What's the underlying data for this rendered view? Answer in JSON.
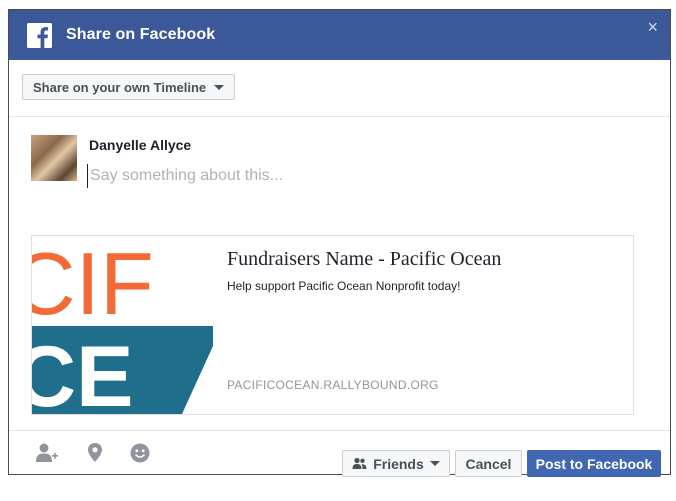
{
  "header": {
    "title": "Share on Facebook",
    "close_label": "×"
  },
  "selector": {
    "label": "Share on your own Timeline"
  },
  "composer": {
    "user_name": "Danyelle Allyce",
    "placeholder": "Say something about this...",
    "value": ""
  },
  "preview": {
    "title": "Fundraisers Name - Pacific Ocean",
    "description": "Help support Pacific Ocean Nonprofit today!",
    "url": "PACIFICOCEAN.RALLYBOUND.ORG",
    "image_text_top": "CIF",
    "image_text_bottom": "CE"
  },
  "footer": {
    "icons": [
      "tag-friends-icon",
      "location-icon",
      "emoji-icon"
    ],
    "audience_label": "Friends",
    "cancel_label": "Cancel",
    "post_label": "Post to Facebook"
  },
  "colors": {
    "brand": "#3b5998",
    "post_button": "#4267b2",
    "preview_orange": "#f26a36",
    "preview_blue": "#1f6e8c"
  }
}
